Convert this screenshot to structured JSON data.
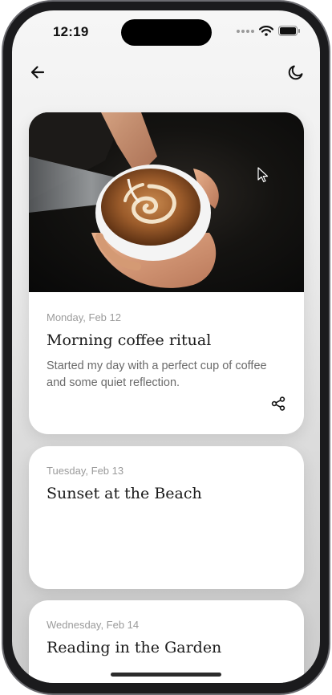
{
  "status_bar": {
    "time": "12:19"
  },
  "nav": {
    "back_icon": "arrow-left-icon",
    "theme_icon": "moon-icon"
  },
  "entries": [
    {
      "date": "Monday, Feb 12",
      "title": "Morning coffee ritual",
      "text": "Started my day with a perfect cup of coffee and some quiet reflection.",
      "image": "latte-art-photo",
      "share_icon": "share-icon"
    },
    {
      "date": "Tuesday, Feb 13",
      "title": "Sunset at the Beach"
    },
    {
      "date": "Wednesday, Feb 14",
      "title": "Reading in the Garden"
    }
  ],
  "colors": {
    "card_background": "#ffffff",
    "title_text": "#1a1a1a",
    "date_text": "#9b9b9b",
    "body_text": "#6a6a6a"
  }
}
